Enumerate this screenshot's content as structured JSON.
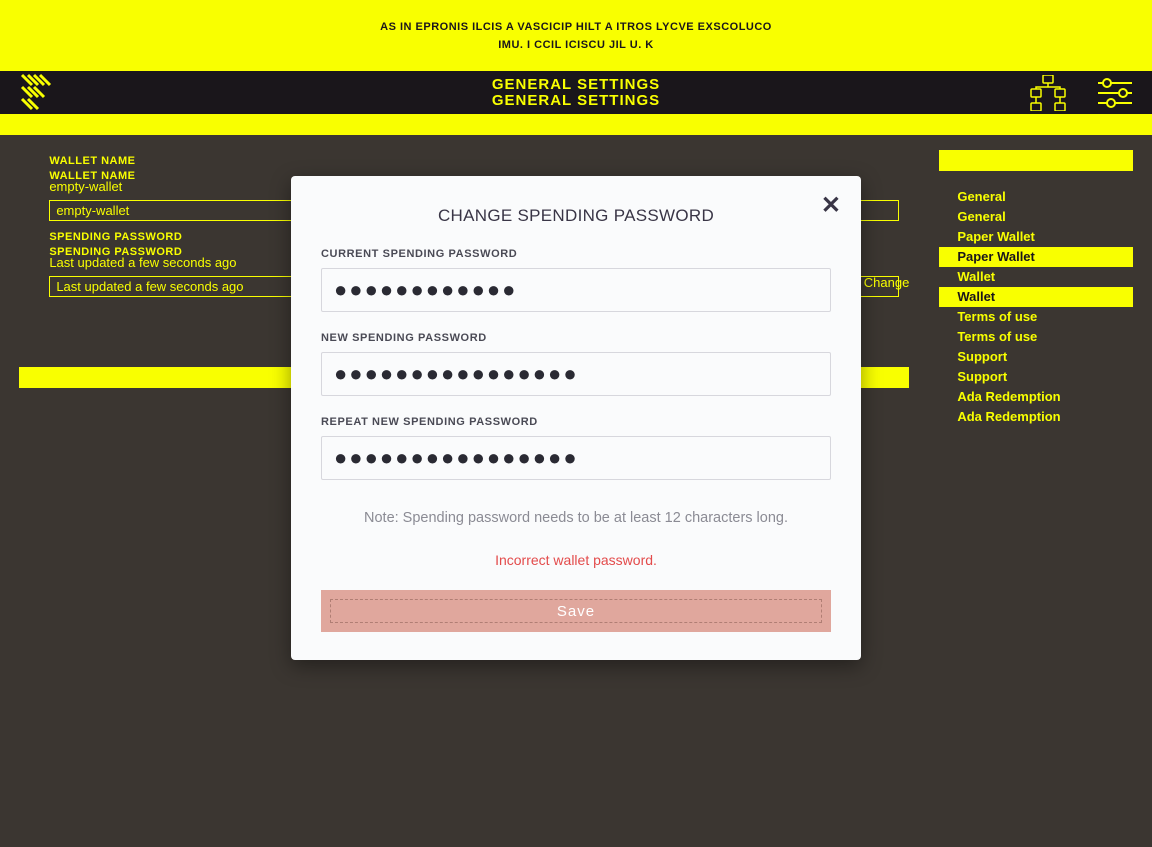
{
  "banner": {
    "line1": "AS IN EPRONIS ILCIS A VASCICIP HILT A ITROS LYCVE EXSCOLUCO",
    "line2": "IMU. I CCIL ICISCU JIL U. K"
  },
  "header": {
    "title": "GENERAL SETTINGS"
  },
  "content": {
    "walletName": {
      "label": "WALLET NAME",
      "value": "empty-wallet"
    },
    "spendingPassword": {
      "label": "SPENDING PASSWORD",
      "updated": "Last updated a few seconds ago",
      "change": "Change"
    }
  },
  "sidebar": {
    "items": [
      {
        "label": "General",
        "active": false
      },
      {
        "label": "General",
        "active": false
      },
      {
        "label": "Paper Wallet",
        "active": false
      },
      {
        "label": "Paper Wallet",
        "active": true
      },
      {
        "label": "Wallet",
        "active": false
      },
      {
        "label": "Wallet",
        "active": true
      },
      {
        "label": "Terms of use",
        "active": false
      },
      {
        "label": "Terms of use",
        "active": false
      },
      {
        "label": "Support",
        "active": false
      },
      {
        "label": "Support",
        "active": false
      },
      {
        "label": "Ada Redemption",
        "active": false
      },
      {
        "label": "Ada Redemption",
        "active": false
      }
    ]
  },
  "modal": {
    "title": "CHANGE SPENDING PASSWORD",
    "currentLabel": "CURRENT SPENDING PASSWORD",
    "currentDots": "●●●●●●●●●●●●",
    "newLabel": "NEW SPENDING PASSWORD",
    "newDots": "●●●●●●●●●●●●●●●●",
    "repeatLabel": "REPEAT NEW SPENDING PASSWORD",
    "repeatDots": "●●●●●●●●●●●●●●●●",
    "note": "Note: Spending password needs to be at least 12 characters long.",
    "error": "Incorrect wallet password.",
    "save": "Save"
  }
}
